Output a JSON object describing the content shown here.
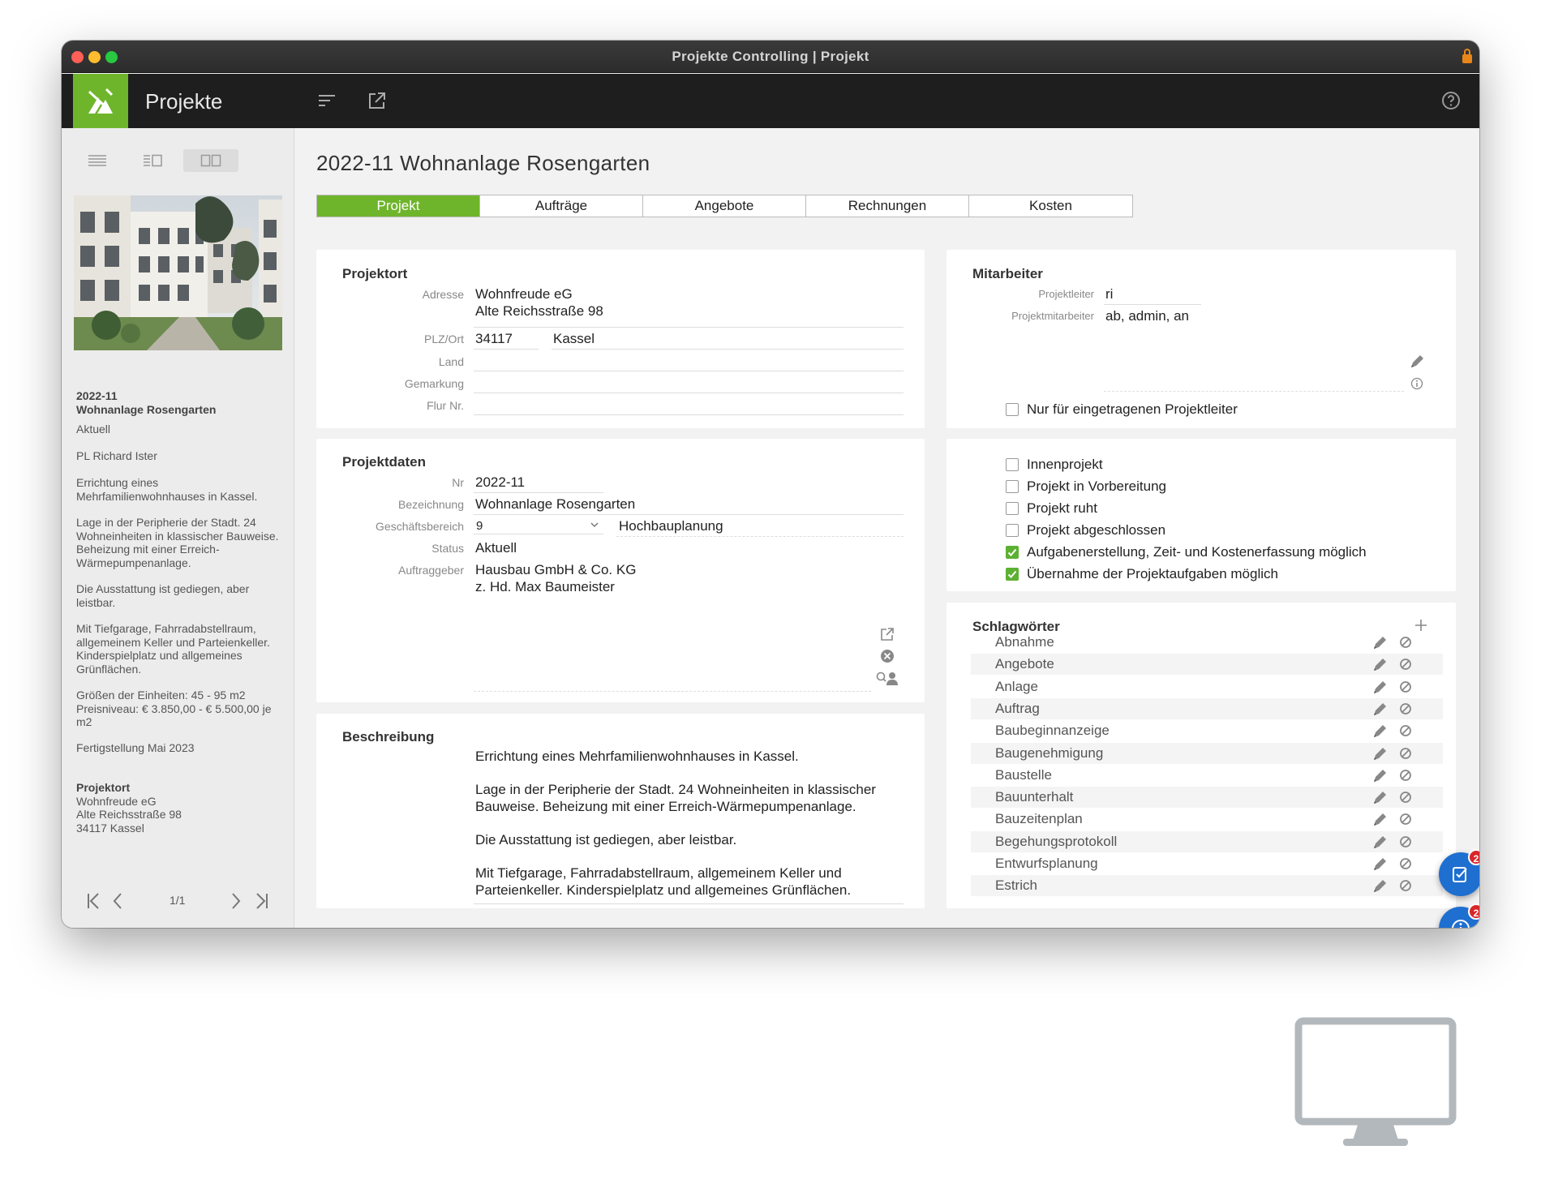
{
  "window": {
    "title": "Projekte Controlling | Projekt",
    "traffic_colors": [
      "#ff5f57",
      "#febc2e",
      "#28c840"
    ]
  },
  "toolbar": {
    "app_title": "Projekte",
    "accent": "#6fb52c",
    "icons": [
      "logo-icon",
      "menu-lines-icon",
      "external-link-icon",
      "help-icon"
    ]
  },
  "sidebar": {
    "project_number": "2022-11",
    "project_name": "Wohnanlage Rosengarten",
    "status": "Aktuell",
    "pl": "PL Richard Ister",
    "desc_1": "Errichtung eines Mehrfamilienwohnhauses in Kassel.",
    "desc_2": "Lage in der Peripherie der Stadt. 24 Wohneinheiten in klassischer Bauweise. Beheizung mit einer Erreich-Wärmepumpenanlage.",
    "desc_3": "Die Ausstattung ist gediegen, aber leistbar.",
    "desc_4": "Mit Tiefgarage, Fahrradabstellraum, allgemeinem Keller und Parteienkeller. Kinderspielplatz und allgemeines Grünflächen.",
    "desc_5": "Größen der Einheiten: 45 - 95 m2 Preisniveau: € 3.850,00 - € 5.500,00 je m2",
    "desc_6": "Fertigstellung Mai 2023",
    "loc_heading": "Projektort",
    "loc_1": "Wohnfreude eG",
    "loc_2": "Alte Reichsstraße 98",
    "loc_3": "34117 Kassel",
    "pager": "1/1"
  },
  "main": {
    "title": "2022-11 Wohnanlage Rosengarten",
    "tabs": [
      "Projekt",
      "Aufträge",
      "Angebote",
      "Rechnungen",
      "Kosten"
    ]
  },
  "projektort": {
    "heading": "Projektort",
    "adresse_label": "Adresse",
    "adresse_1": "Wohnfreude eG",
    "adresse_2": "Alte Reichsstraße 98",
    "plz_label": "PLZ/Ort",
    "plz": "34117",
    "ort": "Kassel",
    "land_label": "Land",
    "gemarkung_label": "Gemarkung",
    "flur_label": "Flur Nr."
  },
  "projektdaten": {
    "heading": "Projektdaten",
    "nr_label": "Nr",
    "nr": "2022-11",
    "bez_label": "Bezeichnung",
    "bez": "Wohnanlage Rosengarten",
    "gb_label": "Geschäftsbereich",
    "gb_value": "9",
    "gb_text": "Hochbauplanung",
    "status_label": "Status",
    "status": "Aktuell",
    "ag_label": "Auftraggeber",
    "ag_1": "Hausbau GmbH & Co. KG",
    "ag_2": "z. Hd. Max Baumeister"
  },
  "beschreibung": {
    "heading": "Beschreibung",
    "p1": "Errichtung eines Mehrfamilienwohnhauses in Kassel.",
    "p2a": "Lage in der Peripherie der Stadt. 24 Wohneinheiten in klassischer",
    "p2b": "Bauweise. Beheizung mit einer Erreich-Wärmepumpenanlage.",
    "p3": "Die Ausstattung ist gediegen, aber leistbar.",
    "p4a": "Mit Tiefgarage, Fahrradabstellraum, allgemeinem Keller und",
    "p4b": "Parteienkeller. Kinderspielplatz und allgemeines Grünflächen."
  },
  "mitarbeiter": {
    "heading": "Mitarbeiter",
    "pl_label": "Projektleiter",
    "pl": "ri",
    "pm_label": "Projektmitarbeiter",
    "pm": "ab, admin, an",
    "only_label": "Nur für eingetragenen Projektleiter",
    "only_checked": false
  },
  "options": [
    {
      "label": "Innenprojekt",
      "checked": false
    },
    {
      "label": "Projekt in Vorbereitung",
      "checked": false
    },
    {
      "label": "Projekt ruht",
      "checked": false
    },
    {
      "label": "Projekt abgeschlossen",
      "checked": false
    },
    {
      "label": "Aufgabenerstellung, Zeit- und Kostenerfassung möglich",
      "checked": true
    },
    {
      "label": "Übernahme der Projektaufgaben möglich",
      "checked": true
    }
  ],
  "schlagwoerter": {
    "heading": "Schlagwörter",
    "items": [
      "Abnahme",
      "Angebote",
      "Anlage",
      "Auftrag",
      "Baubeginnanzeige",
      "Baugenehmigung",
      "Baustelle",
      "Bauunterhalt",
      "Bauzeitenplan",
      "Begehungsprotokoll",
      "Entwurfsplanung",
      "Estrich"
    ]
  },
  "fabs": {
    "tasks_badge": "2",
    "info_badge": "2"
  }
}
